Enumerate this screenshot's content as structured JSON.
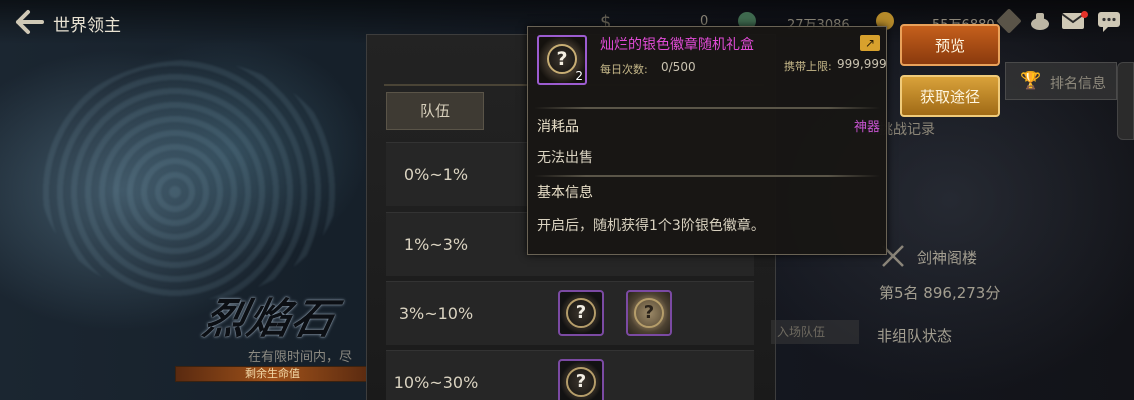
{
  "header": {
    "title": "世界领主",
    "currencies": [
      "0",
      "27万3086",
      "55万6880"
    ]
  },
  "background_art": {
    "title": "烈焰石",
    "subtitle": "在有限时间内，尽",
    "bar_text": "剩余生命值"
  },
  "panel": {
    "team_tab": "队伍",
    "rows": [
      {
        "label": "0%~1%",
        "rewards": []
      },
      {
        "label": "1%~3%",
        "rewards": []
      },
      {
        "label": "3%~10%",
        "rewards": [
          "purple-mystery-box",
          "gold-mystery-box"
        ]
      },
      {
        "label": "10%~30%",
        "rewards": [
          "purple-mystery-box"
        ]
      }
    ]
  },
  "buttons": {
    "preview": "预览",
    "source": "获取途径"
  },
  "right": {
    "rank_info": "排名信息",
    "no_record": "无挑战记录",
    "player_name": "剑神阁楼",
    "rank_score": "第5名 896,273分",
    "team_label": "入场队伍",
    "team_status": "非组队状态"
  },
  "tooltip": {
    "name": "灿烂的银色徽章随机礼盒",
    "count": "2",
    "daily_label": "每日次数:",
    "daily_value": "0/500",
    "carry_label": "携带上限:",
    "carry_value": "999,999",
    "type": "消耗品",
    "class": "神器",
    "no_sell": "无法出售",
    "basic_info": "基本信息",
    "description": "开启后，随机获得1个3阶银色徽章。"
  },
  "colors": {
    "item_name": "#e04bd6",
    "item_border": "#9c5cd0",
    "preview_button": "#c5601c",
    "source_button": "#d9a23a"
  }
}
